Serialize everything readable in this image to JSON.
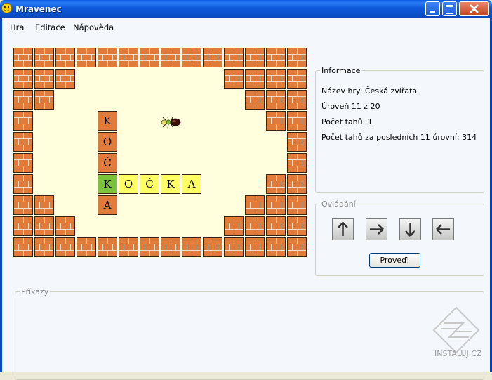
{
  "window": {
    "title": "Mravenec",
    "app_icon": "smiley-face-icon",
    "controls": [
      "minimize-icon",
      "maximize-icon",
      "close-icon"
    ]
  },
  "menu": [
    "Hra",
    "Editace",
    "Nápověda"
  ],
  "board": {
    "wall_cells": [
      [
        0,
        0
      ],
      [
        1,
        0
      ],
      [
        2,
        0
      ],
      [
        3,
        0
      ],
      [
        4,
        0
      ],
      [
        5,
        0
      ],
      [
        6,
        0
      ],
      [
        7,
        0
      ],
      [
        8,
        0
      ],
      [
        9,
        0
      ],
      [
        10,
        0
      ],
      [
        11,
        0
      ],
      [
        12,
        0
      ],
      [
        13,
        0
      ],
      [
        0,
        1
      ],
      [
        1,
        1
      ],
      [
        2,
        1
      ],
      [
        10,
        1
      ],
      [
        11,
        1
      ],
      [
        12,
        1
      ],
      [
        13,
        1
      ],
      [
        0,
        2
      ],
      [
        1,
        2
      ],
      [
        11,
        2
      ],
      [
        12,
        2
      ],
      [
        13,
        2
      ],
      [
        0,
        3
      ],
      [
        12,
        3
      ],
      [
        13,
        3
      ],
      [
        0,
        4
      ],
      [
        13,
        4
      ],
      [
        0,
        5
      ],
      [
        13,
        5
      ],
      [
        0,
        6
      ],
      [
        12,
        6
      ],
      [
        13,
        6
      ],
      [
        0,
        7
      ],
      [
        1,
        7
      ],
      [
        11,
        7
      ],
      [
        12,
        7
      ],
      [
        13,
        7
      ],
      [
        0,
        8
      ],
      [
        1,
        8
      ],
      [
        2,
        8
      ],
      [
        10,
        8
      ],
      [
        11,
        8
      ],
      [
        12,
        8
      ],
      [
        13,
        8
      ],
      [
        0,
        9
      ],
      [
        1,
        9
      ],
      [
        2,
        9
      ],
      [
        3,
        9
      ],
      [
        4,
        9
      ],
      [
        5,
        9
      ],
      [
        6,
        9
      ],
      [
        7,
        9
      ],
      [
        8,
        9
      ],
      [
        9,
        9
      ],
      [
        10,
        9
      ],
      [
        11,
        9
      ],
      [
        12,
        9
      ],
      [
        13,
        9
      ]
    ],
    "letter_tiles": [
      {
        "col": 4,
        "row": 3,
        "letter": "K",
        "color": "orange"
      },
      {
        "col": 4,
        "row": 4,
        "letter": "O",
        "color": "orange"
      },
      {
        "col": 4,
        "row": 5,
        "letter": "Č",
        "color": "orange"
      },
      {
        "col": 4,
        "row": 6,
        "letter": "K",
        "color": "green"
      },
      {
        "col": 5,
        "row": 6,
        "letter": "O",
        "color": "yellow"
      },
      {
        "col": 6,
        "row": 6,
        "letter": "Č",
        "color": "yellow"
      },
      {
        "col": 7,
        "row": 6,
        "letter": "K",
        "color": "yellow"
      },
      {
        "col": 8,
        "row": 6,
        "letter": "A",
        "color": "yellow"
      },
      {
        "col": 4,
        "row": 7,
        "letter": "A",
        "color": "orange"
      }
    ],
    "ant_icon": "ant-icon"
  },
  "info": {
    "label": "Informace",
    "game_name": "Název hry: Česká zvířata",
    "level": "Úroveň  11 z 20",
    "moves": "Počet tahů: 1",
    "moves_last": "Počet tahů za  posledních 11 úrovní: 314"
  },
  "controls": {
    "label": "Ovládání",
    "arrows": [
      "arrow-up-icon",
      "arrow-right-icon",
      "arrow-down-icon",
      "arrow-left-icon"
    ],
    "execute_label": "Proveď!"
  },
  "commands": {
    "label": "Příkazy"
  },
  "watermark": {
    "text": "INSTALUJ.CZ"
  },
  "colors": {
    "brick": "#e07b3c",
    "floor": "#ffffdd",
    "tile_yellow": "#ffff66",
    "tile_green": "#7cc23a",
    "titlebar": "#0a5be0"
  }
}
